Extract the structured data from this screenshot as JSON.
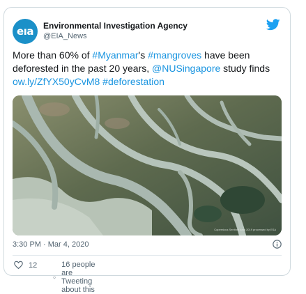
{
  "tweet": {
    "author": {
      "display_name": "Environmental Investigation Agency",
      "handle": "@EIA_News",
      "avatar_text": "eıa",
      "avatar_color": "#1b90c8"
    },
    "text_parts": [
      {
        "text": "More than 60% of ",
        "kind": "plain"
      },
      {
        "text": "#Myanmar",
        "kind": "hashtag"
      },
      {
        "text": "'s ",
        "kind": "plain"
      },
      {
        "text": "#mangroves",
        "kind": "hashtag"
      },
      {
        "text": " have been deforested in the past 20 years, ",
        "kind": "plain"
      },
      {
        "text": "@NUSingapore",
        "kind": "mention"
      },
      {
        "text": " study finds ",
        "kind": "plain"
      },
      {
        "text": "ow.ly/ZfYX50yCvM8",
        "kind": "url"
      },
      {
        "text": " ",
        "kind": "plain"
      },
      {
        "text": "#deforestation",
        "kind": "hashtag"
      }
    ],
    "media": {
      "icon": "satellite-image",
      "credit": "Copernicus Sentinel data 2019 processed by ESA"
    },
    "timestamp": "3:30 PM · Mar 4, 2020",
    "likes": "12",
    "tweeting_about": "16 people are Tweeting about this"
  },
  "icons": {
    "brand": "twitter-bird-icon",
    "info": "info-icon",
    "like": "heart-icon",
    "reply": "speech-bubble-icon"
  },
  "colors": {
    "link": "#1b95e0",
    "brand": "#1da1f2",
    "secondary_text": "#536471"
  }
}
